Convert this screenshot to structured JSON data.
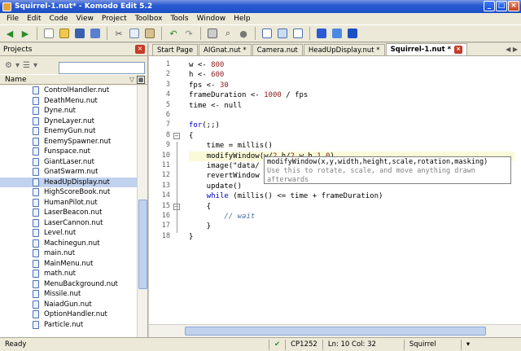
{
  "window": {
    "title": "Squirrel-1.nut* - Komodo Edit 5.2",
    "controls": [
      "_",
      "□",
      "×"
    ]
  },
  "menu": [
    "File",
    "Edit",
    "Code",
    "View",
    "Project",
    "Toolbox",
    "Tools",
    "Window",
    "Help"
  ],
  "toolbar_icons": [
    "back-icon",
    "forward-icon",
    "new-file-icon",
    "open-folder-icon",
    "save-icon",
    "save-all-icon",
    "cut-icon",
    "copy-icon",
    "paste-icon",
    "undo-icon",
    "redo-icon",
    "print-icon",
    "find-icon",
    "run-icon",
    "layout-icon",
    "panel-icon",
    "split-icon",
    "toolbox-icon",
    "help-icon",
    "komodo-icon"
  ],
  "projects_panel": {
    "title": "Projects",
    "close": "×",
    "search_value": "",
    "column_name": "Name",
    "files": [
      "ControlHandler.nut",
      "DeathMenu.nut",
      "Dyne.nut",
      "DyneLayer.nut",
      "EnemyGun.nut",
      "EnemySpawner.nut",
      "Funspace.nut",
      "GiantLaser.nut",
      "GnatSwarm.nut",
      "HeadUpDisplay.nut",
      "HighScoreBook.nut",
      "HumanPilot.nut",
      "LaserBeacon.nut",
      "LaserCannon.nut",
      "Level.nut",
      "Machinegun.nut",
      "main.nut",
      "MainMenu.nut",
      "math.nut",
      "MenuBackground.nut",
      "Missile.nut",
      "NaiadGun.nut",
      "OptionHandler.nut",
      "Particle.nut"
    ],
    "selected_index": 9
  },
  "tabs": [
    {
      "label": "Start Page",
      "active": false,
      "closable": false
    },
    {
      "label": "AIGnat.nut *",
      "active": false,
      "closable": false
    },
    {
      "label": "Camera.nut",
      "active": false,
      "closable": false
    },
    {
      "label": "HeadUpDisplay.nut *",
      "active": false,
      "closable": false
    },
    {
      "label": "Squirrel-1.nut *",
      "active": true,
      "closable": true
    }
  ],
  "code_lines": [
    "w <- 800",
    "h <- 600",
    "fps <- 30",
    "frameDuration <- 1000 / fps",
    "time <- null",
    "",
    "for(;;)",
    "{",
    "    time = millis()",
    "    modifyWindow(w/2,h/2,w,h,1,0)",
    "    image(\"data/",
    "    revertWindow",
    "    update()",
    "    while (millis() <= time + frameDuration)",
    "    {",
    "        // wait",
    "    }",
    "}"
  ],
  "current_line": 10,
  "tooltip": {
    "signature": "modifyWindow(x,y,width,height,scale,rotation,masking)",
    "description_1": "Use this to rotate, scale, and move anything drawn",
    "description_2": "afterwards"
  },
  "status": {
    "ready": "Ready",
    "encoding": "CP1252",
    "position": "Ln: 10 Col: 32",
    "language": "Squirrel"
  }
}
